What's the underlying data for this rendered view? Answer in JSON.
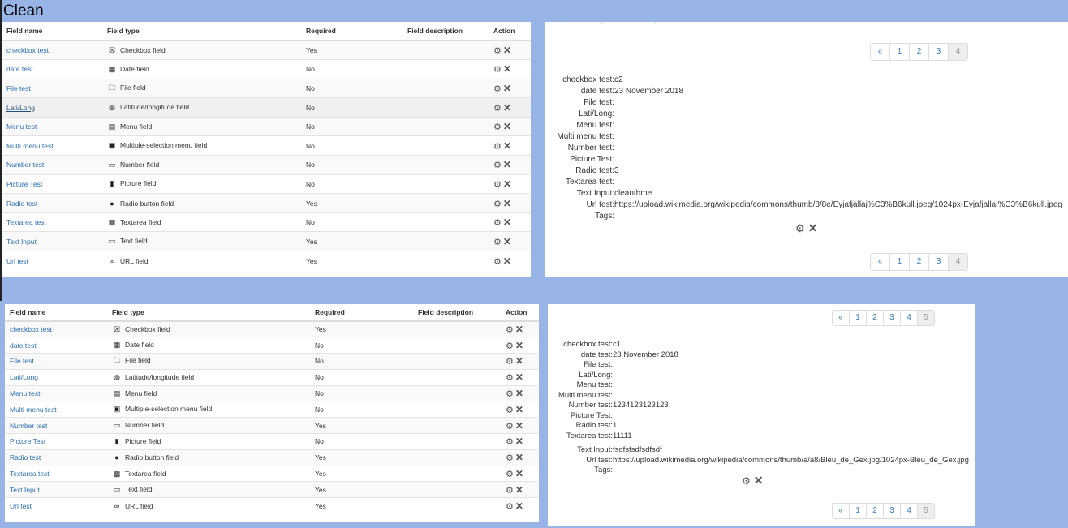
{
  "caption": "Clean",
  "field_table": {
    "headers": [
      "Field name",
      "Field type",
      "Required",
      "Field description",
      "Action"
    ],
    "gear_icon": "gear-icon",
    "close_icon": "close-icon"
  },
  "table1": {
    "rows": [
      {
        "name": "checkbox test",
        "type": "Checkbox field",
        "icon": "☒",
        "required": "Yes"
      },
      {
        "name": "date test",
        "type": "Date field",
        "icon": "▦",
        "required": "No"
      },
      {
        "name": "File test",
        "type": "File field",
        "icon": "🗀",
        "required": "No"
      },
      {
        "name": "Lati/Long",
        "type": "Latitude/longitude field",
        "icon": "◍",
        "required": "No"
      },
      {
        "name": "Menu test",
        "type": "Menu field",
        "icon": "▤",
        "required": "No"
      },
      {
        "name": "Multi menu test",
        "type": "Multiple-selection menu field",
        "icon": "▣",
        "required": "No"
      },
      {
        "name": "Number test",
        "type": "Number field",
        "icon": "▭",
        "required": "No"
      },
      {
        "name": "Picture Test",
        "type": "Picture field",
        "icon": "▮",
        "required": "No"
      },
      {
        "name": "Radio test",
        "type": "Radio button field",
        "icon": "●",
        "required": "Yes"
      },
      {
        "name": "Textarea test",
        "type": "Textarea field",
        "icon": "▩",
        "required": "No"
      },
      {
        "name": "Text Input",
        "type": "Text field",
        "icon": "▭",
        "required": "Yes"
      },
      {
        "name": "Url test",
        "type": "URL field",
        "icon": "∞",
        "required": "Yes"
      }
    ]
  },
  "table2": {
    "rows": [
      {
        "name": "checkbox test",
        "type": "Checkbox field",
        "icon": "☒",
        "required": "Yes"
      },
      {
        "name": "date test",
        "type": "Date field",
        "icon": "▦",
        "required": "No"
      },
      {
        "name": "File test",
        "type": "File field",
        "icon": "🗀",
        "required": "No"
      },
      {
        "name": "Lati/Long",
        "type": "Latitude/longitude field",
        "icon": "◍",
        "required": "No"
      },
      {
        "name": "Menu test",
        "type": "Menu field",
        "icon": "▤",
        "required": "No"
      },
      {
        "name": "Multi menu test",
        "type": "Multiple-selection menu field",
        "icon": "▣",
        "required": "No"
      },
      {
        "name": "Number test",
        "type": "Number field",
        "icon": "▭",
        "required": "Yes"
      },
      {
        "name": "Picture Test",
        "type": "Picture field",
        "icon": "▮",
        "required": "No"
      },
      {
        "name": "Radio test",
        "type": "Radio button field",
        "icon": "●",
        "required": "Yes"
      },
      {
        "name": "Textarea test",
        "type": "Textarea field",
        "icon": "▩",
        "required": "Yes"
      },
      {
        "name": "Text Input",
        "type": "Text field",
        "icon": "▭",
        "required": "Yes"
      },
      {
        "name": "Url test",
        "type": "URL field",
        "icon": "∞",
        "required": "Yes"
      }
    ]
  },
  "record1": {
    "pager": [
      "«",
      "1",
      "2",
      "3",
      "4"
    ],
    "fields": [
      {
        "label": "checkbox test:",
        "value": "c2"
      },
      {
        "label": "date test:",
        "value": "23 November 2018"
      },
      {
        "label": "File test:",
        "value": ""
      },
      {
        "label": "Lati/Long:",
        "value": ""
      },
      {
        "label": "Menu test:",
        "value": ""
      },
      {
        "label": "Multi menu test:",
        "value": ""
      },
      {
        "label": "Number test:",
        "value": ""
      },
      {
        "label": "Picture Test:",
        "value": ""
      },
      {
        "label": "Radio test:",
        "value": "3"
      },
      {
        "label": "Textarea test:",
        "value": ""
      },
      {
        "label": "Text Input:",
        "value": "cleanthme"
      },
      {
        "label": "Url test:",
        "value": "https://upload.wikimedia.org/wikipedia/commons/thumb/8/8e/Eyjafjallaj%C3%B6kull.jpeg/1024px-Eyjafjallaj%C3%B6kull.jpeg"
      },
      {
        "label": "Tags:",
        "value": ""
      }
    ]
  },
  "record2": {
    "pager": [
      "«",
      "1",
      "2",
      "3",
      "4",
      "5"
    ],
    "fields": [
      {
        "label": "checkbox test:",
        "value": "c1"
      },
      {
        "label": "date test:",
        "value": "23 November 2018"
      },
      {
        "label": "File test:",
        "value": ""
      },
      {
        "label": "Lati/Long:",
        "value": ""
      },
      {
        "label": "Menu test:",
        "value": ""
      },
      {
        "label": "Multi menu test:",
        "value": ""
      },
      {
        "label": "Number test:",
        "value": "1234123123123"
      },
      {
        "label": "Picture Test:",
        "value": ""
      },
      {
        "label": "Radio test:",
        "value": "1"
      },
      {
        "label": "Textarea test:",
        "value": "11111"
      },
      {
        "label": "Text Input:",
        "value": "fsdfsfsdfsdfsdf"
      },
      {
        "label": "Url test:",
        "value": "https://upload.wikimedia.org/wikipedia/commons/thumb/a/a8/Bleu_de_Gex.jpg/1024px-Bleu_de_Gex.jpg"
      },
      {
        "label": "Tags:",
        "value": ""
      }
    ]
  }
}
